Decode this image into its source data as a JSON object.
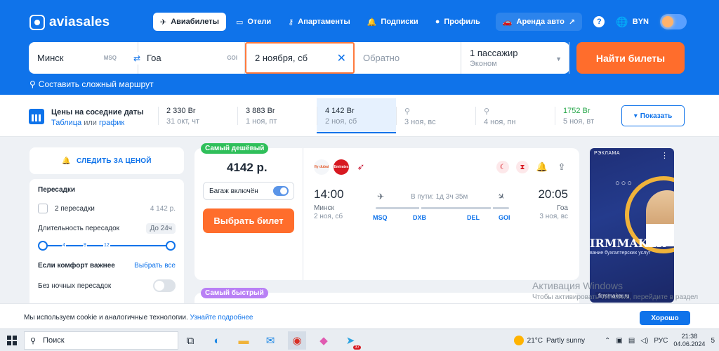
{
  "header": {
    "logo_text": "aviasales",
    "tabs": [
      {
        "label": "Авиабилеты",
        "icon": "plane-icon"
      },
      {
        "label": "Отели",
        "icon": "bed-icon"
      },
      {
        "label": "Апартаменты",
        "icon": "key-icon"
      },
      {
        "label": "Подписки",
        "icon": "bell-icon"
      },
      {
        "label": "Профиль",
        "icon": "user-icon"
      }
    ],
    "car_tab": "Аренда авто",
    "car_external": "↗",
    "help": "?",
    "currency": "BYN"
  },
  "search": {
    "from": "Минск",
    "from_code": "MSQ",
    "to": "Гоа",
    "to_code": "GOI",
    "date": "2 ноября, сб",
    "return_placeholder": "Обратно",
    "passengers": "1 пассажир",
    "class": "Эконом",
    "button": "Найти билеты",
    "complex_route": "Составить сложный маршрут"
  },
  "price_strip": {
    "title": "Цены на соседние даты",
    "sub_table": "Таблица",
    "sub_or": "или",
    "sub_chart": "график",
    "cells": [
      {
        "price": "2 330 Br",
        "date": "31 окт, чт"
      },
      {
        "price": "3 883 Br",
        "date": "1 ноя, пт"
      },
      {
        "price": "4 142 Br",
        "date": "2 ноя, сб"
      },
      {
        "price": "",
        "date": "3 ноя, вс"
      },
      {
        "price": "",
        "date": "4 ноя, пн"
      },
      {
        "price": "1752 Br",
        "date": "5 ноя, вт"
      }
    ],
    "show_button": "Показать"
  },
  "filters": {
    "follow_price": "СЛЕДИТЬ ЗА ЦЕНОЙ",
    "transfers_title": "Пересадки",
    "two_transfers": "2 пересадки",
    "two_transfers_price": "4 142 р.",
    "duration_label": "Длительность пересадок",
    "duration_value": "До 24ч",
    "slider_ticks": [
      "4",
      "8",
      "12"
    ],
    "comfort_title": "Если комфорт важнее",
    "select_all": "Выбрать все",
    "no_night": "Без ночных пересадок"
  },
  "ticket": {
    "badge_cheapest": "Самый дешёвый",
    "badge_fastest": "Самый быстрый",
    "price": "4142 р.",
    "baggage": "Багаж включён",
    "select_button": "Выбрать билет",
    "airlines": [
      "flydubai",
      "Emirates",
      "Air India"
    ],
    "dep_time": "14:00",
    "dep_city": "Минск",
    "dep_date": "2 ноя, сб",
    "arr_time": "20:05",
    "arr_city": "Гоа",
    "arr_date": "3 ноя, вс",
    "duration": "В пути: 1д 3ч 35м",
    "route_codes": [
      "MSQ",
      "DXB",
      "DEL",
      "GOI"
    ]
  },
  "ad": {
    "label": "РЭКЛАМА",
    "brand": "IRMMAKER",
    "tagline": "вание бухгалтерских услуг",
    "site": "firmmaker.ru"
  },
  "watermark": {
    "title": "Активация Windows",
    "text": "Чтобы активировать Windows, перейдите в раздел \"Параметры\"."
  },
  "cookie": {
    "text": "Мы используем cookie и аналогичные технологии.",
    "link": "Узнайте подробнее",
    "button": "Хорошо"
  },
  "taskbar": {
    "search": "Поиск",
    "telegram_badge": "37",
    "temperature": "21°C",
    "weather": "Partly sunny",
    "lang": "РУС",
    "time": "21:38",
    "date": "04.06.2024",
    "notifications": "5"
  },
  "colors": {
    "brand_blue": "#0f73ea",
    "accent_orange": "#ff6d2c",
    "green": "#2fbf5a",
    "purple": "#b980f5"
  }
}
